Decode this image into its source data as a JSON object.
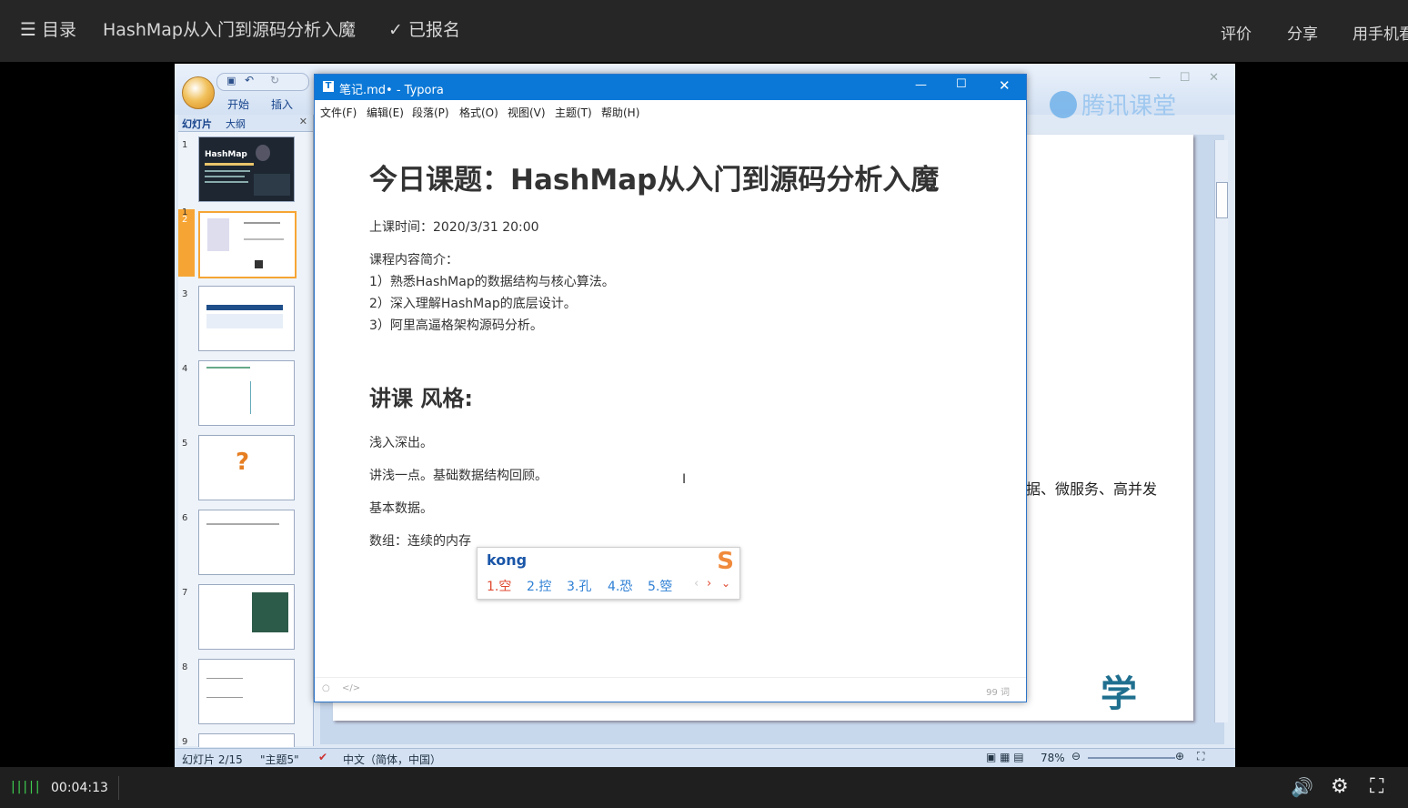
{
  "topbar": {
    "menu_icon": "list-icon",
    "menu_label": "目录",
    "course_title": "HashMap从入门到源码分析入魔",
    "check_icon": "check-icon",
    "enrolled_label": "已报名",
    "review_label": "评价",
    "share_label": "分享",
    "mobile_label": "用手机看"
  },
  "ppt": {
    "tab_home": "开始",
    "tab_insert": "插入",
    "panel_tab_slides": "幻灯片",
    "panel_tab_outline": "大纲",
    "thumb_numbers": [
      "1",
      "2",
      "3",
      "4",
      "5",
      "6",
      "7",
      "8",
      "9"
    ],
    "thumb1_title": "HashMap",
    "slide_text": "据、微服务、高并发",
    "watermark": "腾讯课堂",
    "logo_text": "学",
    "status_slide": "幻灯片 2/15",
    "status_theme": "\"主题5\"",
    "status_lang": "中文（简体，中国）",
    "zoom": "78%"
  },
  "typora": {
    "window_title": "笔记.md• - Typora",
    "menu": [
      "文件(F)",
      "编辑(E)",
      "段落(P)",
      "格式(O)",
      "视图(V)",
      "主题(T)",
      "帮助(H)"
    ],
    "h1": "今日课题：HashMap从入门到源码分析入魔",
    "time_label": "上课时间：2020/3/31 20:00",
    "intro_title": "课程内容简介：",
    "items": [
      "1）熟悉HashMap的数据结构与核心算法。",
      "2）深入理解HashMap的底层设计。",
      "3）阿里高逼格架构源码分析。"
    ],
    "h2": "讲课 风格:",
    "p1": "浅入深出。",
    "p2": "讲浅一点。基础数据结构回顾。",
    "p3": "基本数据。",
    "p4": "数组：连续的内存",
    "word_count": "99 词"
  },
  "ime": {
    "input": "kong",
    "candidates": [
      "1.空",
      "2.控",
      "3.孔",
      "4.恐",
      "5.箜"
    ]
  },
  "player": {
    "time": "00:04:13",
    "volume_icon": "volume-icon",
    "settings_icon": "gear-icon",
    "fullscreen_icon": "fullscreen-icon"
  }
}
